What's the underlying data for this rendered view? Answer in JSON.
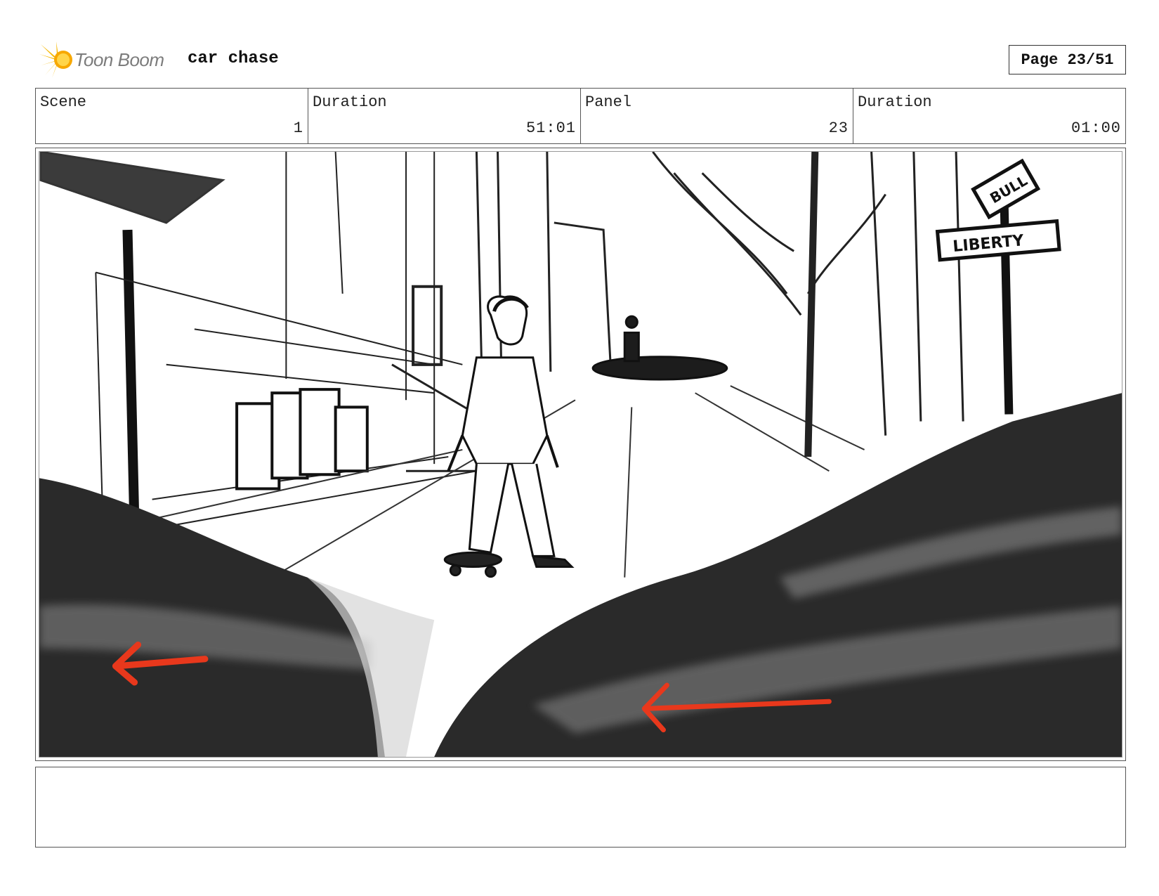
{
  "header": {
    "logo_text": "Toon Boom",
    "project_title": "car chase",
    "page_label": "Page 23/51"
  },
  "info": [
    {
      "label": "Scene",
      "value": "1"
    },
    {
      "label": "Duration",
      "value": "51:01"
    },
    {
      "label": "Panel",
      "value": "23"
    },
    {
      "label": "Duration",
      "value": "01:00"
    }
  ],
  "panel": {
    "sign_top": "BULL",
    "sign_bottom": "LIBERTY",
    "arrow_color": "#e8381c",
    "car_color": "#2a2a2a"
  },
  "notes": {
    "text": ""
  },
  "colors": {
    "logo_yellow": "#f5b800",
    "border": "#555555"
  }
}
